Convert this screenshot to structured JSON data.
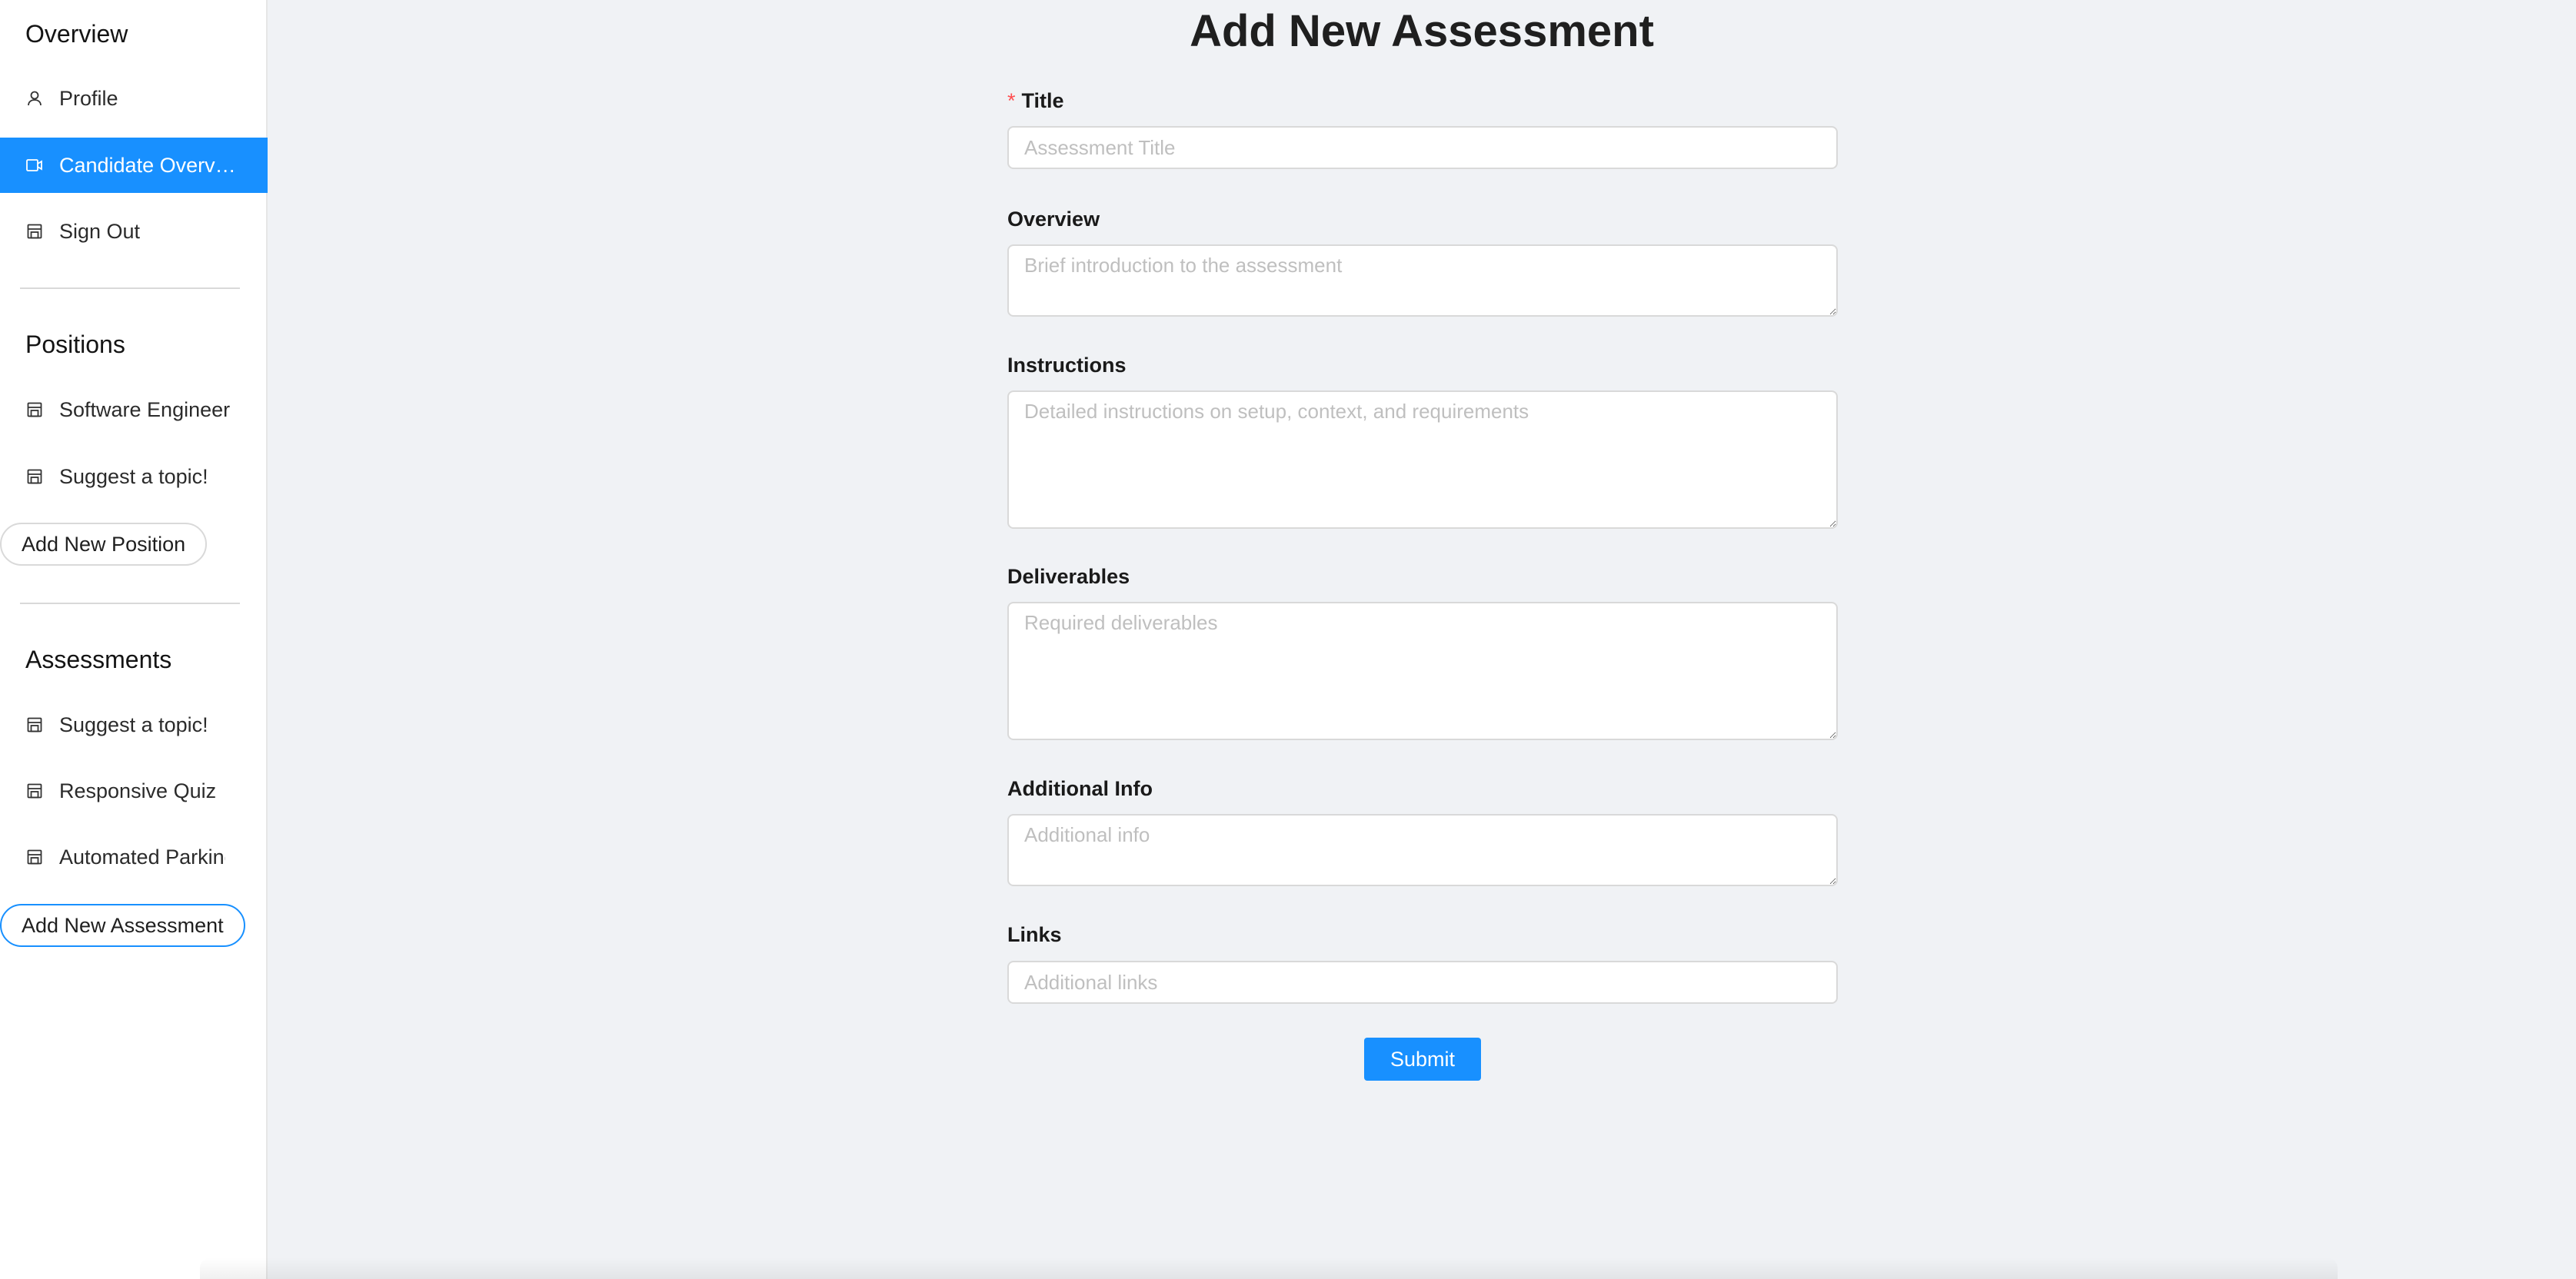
{
  "sidebar": {
    "overview_title": "Overview",
    "overview_items": [
      {
        "label": "Profile",
        "icon": "user-icon"
      },
      {
        "label": "Candidate Overview",
        "icon": "video-camera-icon"
      },
      {
        "label": "Sign Out",
        "icon": "shop-icon"
      }
    ],
    "positions_title": "Positions",
    "positions_items": [
      {
        "label": "Software Engineer",
        "icon": "shop-icon"
      },
      {
        "label": "Suggest a topic!",
        "icon": "shop-icon"
      }
    ],
    "add_position_label": "Add New Position",
    "assessments_title": "Assessments",
    "assessments_items": [
      {
        "label": "Suggest a topic!",
        "icon": "shop-icon"
      },
      {
        "label": "Responsive Quiz",
        "icon": "shop-icon"
      },
      {
        "label": "Automated Parking",
        "icon": "shop-icon"
      }
    ],
    "add_assessment_label": "Add New Assessment"
  },
  "main": {
    "title": "Add New Assessment",
    "fields": {
      "title": {
        "label": "Title",
        "required_mark": "*",
        "placeholder": "Assessment Title"
      },
      "overview": {
        "label": "Overview",
        "placeholder": "Brief introduction to the assessment"
      },
      "instructions": {
        "label": "Instructions",
        "placeholder": "Detailed instructions on setup, context, and requirements"
      },
      "deliverables": {
        "label": "Deliverables",
        "placeholder": "Required deliverables"
      },
      "additional_info": {
        "label": "Additional Info",
        "placeholder": "Additional info"
      },
      "links": {
        "label": "Links",
        "placeholder": "Additional links"
      }
    },
    "submit_label": "Submit"
  },
  "colors": {
    "accent": "#1890ff",
    "required": "#ff4d4f",
    "background": "#f0f2f5",
    "placeholder": "#bfbfbf"
  }
}
